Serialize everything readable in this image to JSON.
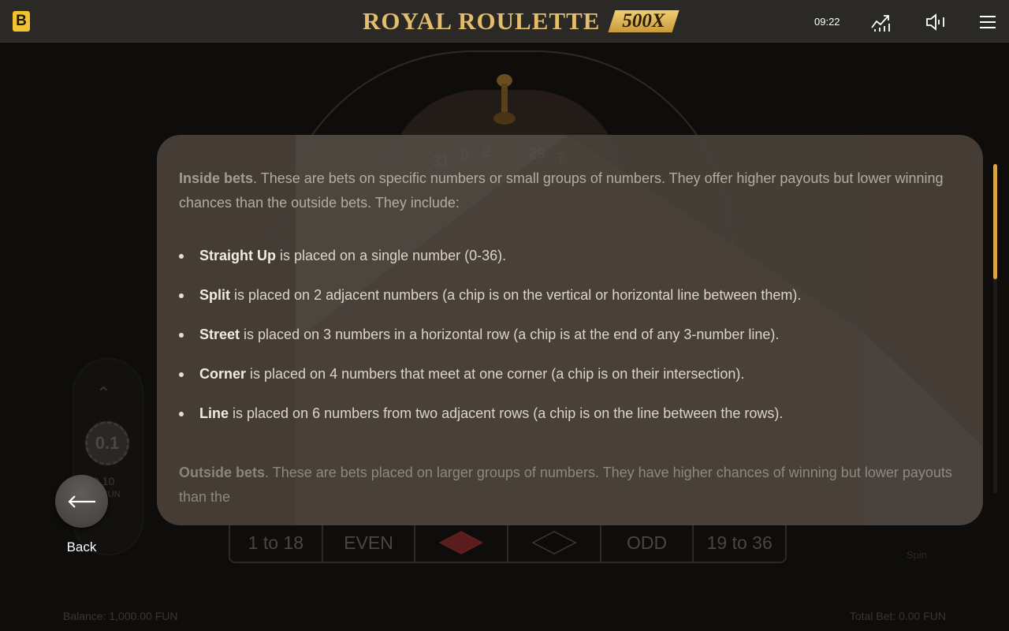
{
  "topbar": {
    "logo_letter": "B",
    "title": "ROYAL ROULETTE",
    "title_badge": "500X",
    "clock": "09:22",
    "icons": [
      "stats-icon",
      "sound-icon",
      "menu-icon"
    ],
    "accent_color": "#f3c230"
  },
  "background": {
    "wheel_numbers": [
      "31",
      "9",
      "2",
      "29",
      "7"
    ],
    "chip_value": "0.1",
    "chip_subvalue": "0.10",
    "chip_unit": "FUN",
    "bet_cells": [
      "1 to 18",
      "EVEN",
      "",
      "",
      "ODD",
      "19 to 36"
    ],
    "balance": "Balance: 1,000.00 FUN",
    "total_bet": "Total Bet: 0.00 FUN",
    "spin_label": "Spin"
  },
  "rules": {
    "inside_title": "Inside bets",
    "inside_text": ". These are bets on specific numbers or small groups of numbers. They offer higher payouts but lower winning chances than the outside bets. They include:",
    "bullets": [
      {
        "term": "Straight Up",
        "text": " is placed on a single number (0-36)."
      },
      {
        "term": "Split",
        "text": " is placed on 2 adjacent numbers (a chip is on the vertical or horizontal line between them)."
      },
      {
        "term": "Street",
        "text": " is placed on 3 numbers in a horizontal row (a chip is at the end of any 3-number line)."
      },
      {
        "term": "Corner",
        "text": " is placed on 4 numbers that meet at one corner (a chip is on their intersection)."
      },
      {
        "term": "Line",
        "text": " is placed on 6 numbers from two adjacent rows (a chip is on the line between the rows)."
      }
    ],
    "outside_title": "Outside bets",
    "outside_text": ". These are bets placed on larger groups of numbers. They have higher chances of winning but lower payouts than the",
    "scroll_fraction": 0.0,
    "scroll_color": "#d9a443"
  },
  "back": {
    "label": "Back"
  }
}
